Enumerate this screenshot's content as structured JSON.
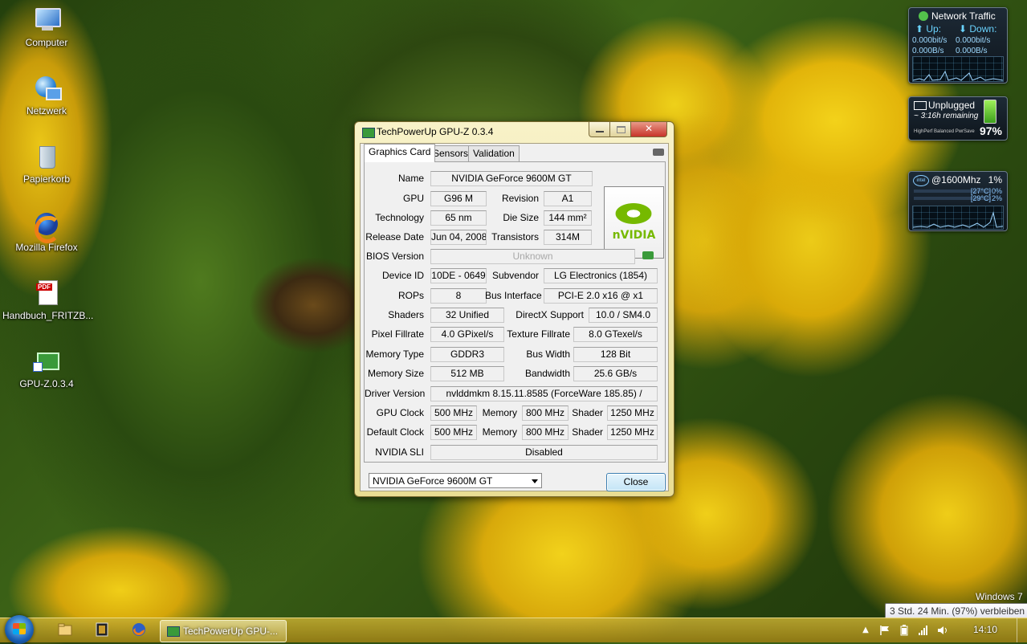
{
  "desktop": {
    "icons": [
      {
        "label": "Computer",
        "icon": "computer-icon"
      },
      {
        "label": "Netzwerk",
        "icon": "network-icon"
      },
      {
        "label": "Papierkorb",
        "icon": "recycle-bin-icon"
      },
      {
        "label": "Mozilla Firefox",
        "icon": "firefox-icon"
      },
      {
        "label": "Handbuch_FRITZB...",
        "icon": "pdf-icon"
      },
      {
        "label": "GPU-Z.0.3.4",
        "icon": "gpuz-icon"
      }
    ],
    "watermark": "Windows 7"
  },
  "gadgets": {
    "network": {
      "title": "Network Traffic",
      "up_label": "Up:",
      "down_label": "Down:",
      "up_bits": "0.000bit/s",
      "down_bits": "0.000bit/s",
      "up_bytes": "0.000B/s",
      "down_bytes": "0.000B/s"
    },
    "battery": {
      "title": "Unplugged",
      "remaining": "~ 3:16h remaining",
      "modes": "HighPerf  Balanced  PwrSave",
      "percent": "97%"
    },
    "cpu": {
      "title": "@1600Mhz",
      "total": "1%",
      "core1_temp": "[27°C]",
      "core1_load": "0%",
      "core2_temp": "[29°C]",
      "core2_load": "2%"
    }
  },
  "window": {
    "title": "TechPowerUp GPU-Z 0.3.4",
    "close_glyph": "✕",
    "tabs": [
      "Graphics Card",
      "Sensors",
      "Validation"
    ],
    "labels": {
      "name": "Name",
      "gpu": "GPU",
      "revision": "Revision",
      "technology": "Technology",
      "die_size": "Die Size",
      "release_date": "Release Date",
      "transistors": "Transistors",
      "bios_version": "BIOS Version",
      "device_id": "Device ID",
      "subvendor": "Subvendor",
      "rops": "ROPs",
      "bus_interface": "Bus Interface",
      "shaders": "Shaders",
      "directx": "DirectX Support",
      "pixel_fillrate": "Pixel Fillrate",
      "texture_fillrate": "Texture Fillrate",
      "memory_type": "Memory Type",
      "bus_width": "Bus Width",
      "memory_size": "Memory Size",
      "bandwidth": "Bandwidth",
      "driver_version": "Driver Version",
      "gpu_clock": "GPU Clock",
      "default_clock": "Default Clock",
      "memory": "Memory",
      "shader": "Shader",
      "nvidia_sli": "NVIDIA SLI"
    },
    "values": {
      "name": "NVIDIA GeForce 9600M GT",
      "gpu": "G96 M",
      "revision": "A1",
      "technology": "65 nm",
      "die_size": "144 mm²",
      "release_date": "Jun 04, 2008",
      "transistors": "314M",
      "bios_version": "Unknown",
      "device_id": "10DE - 0649",
      "subvendor": "LG Electronics (1854)",
      "rops": "8",
      "bus_interface": "PCI-E 2.0 x16 @ x1",
      "shaders": "32 Unified",
      "directx": "10.0 / SM4.0",
      "pixel_fillrate": "4.0 GPixel/s",
      "texture_fillrate": "8.0 GTexel/s",
      "memory_type": "GDDR3",
      "bus_width": "128 Bit",
      "memory_size": "512 MB",
      "bandwidth": "25.6 GB/s",
      "driver_version": "nvlddmkm 8.15.11.8585 (ForceWare 185.85) /",
      "gpu_clock": "500 MHz",
      "gpu_memory": "800 MHz",
      "gpu_shader": "1250 MHz",
      "default_clock": "500 MHz",
      "default_memory": "800 MHz",
      "default_shader": "1250 MHz",
      "nvidia_sli": "Disabled"
    },
    "logo_text": "nVIDIA",
    "card_select": "NVIDIA GeForce 9600M GT",
    "close_button": "Close"
  },
  "taskbar": {
    "task_label": "TechPowerUp GPU-...",
    "clock": "14:10",
    "battery_tooltip": "3 Std. 24 Min. (97%) verbleiben"
  },
  "colors": {
    "nvidia_green": "#76b900",
    "window_frame": "#e9dd93",
    "taskbar": "#c8af32"
  }
}
